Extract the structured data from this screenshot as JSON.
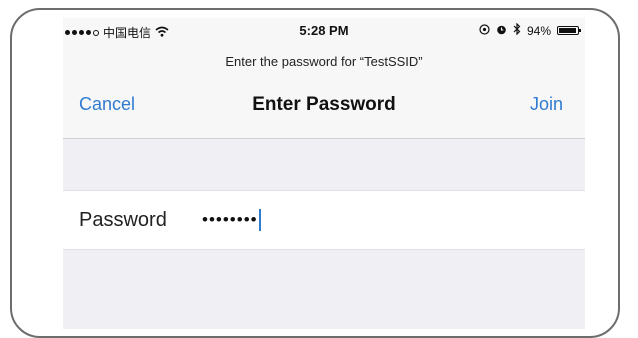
{
  "status_bar": {
    "carrier": "中国电信",
    "time": "5:28 PM",
    "battery_text": "94%",
    "battery_level": 0.94
  },
  "prompt": "Enter the password for “TestSSID”",
  "nav": {
    "cancel_label": "Cancel",
    "title": "Enter Password",
    "join_label": "Join"
  },
  "password_row": {
    "label": "Password",
    "masked_value": "••••••••"
  },
  "colors": {
    "accent": "#2f7bd1",
    "background": "#efeff4"
  },
  "icons": [
    "signal-dots-icon",
    "wifi-icon",
    "location-icon",
    "alarm-icon",
    "bluetooth-icon",
    "battery-icon"
  ]
}
